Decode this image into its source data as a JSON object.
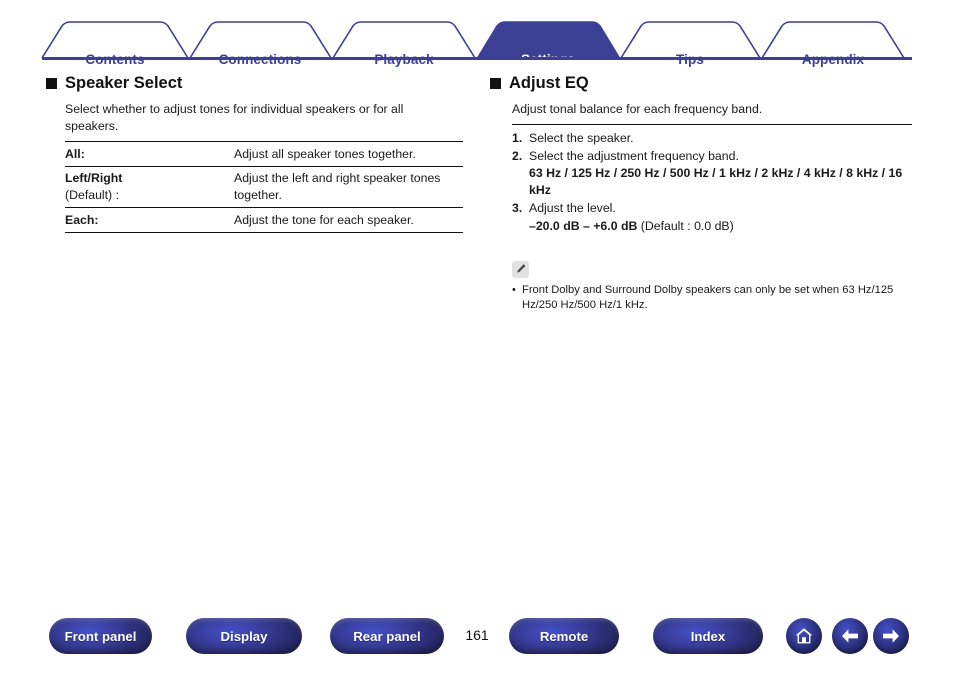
{
  "tabs": [
    {
      "label": "Contents",
      "active": false
    },
    {
      "label": "Connections",
      "active": false
    },
    {
      "label": "Playback",
      "active": false
    },
    {
      "label": "Settings",
      "active": true
    },
    {
      "label": "Tips",
      "active": false
    },
    {
      "label": "Appendix",
      "active": false
    }
  ],
  "left_section": {
    "title": "Speaker Select",
    "intro": "Select whether to adjust tones for individual speakers or for all speakers.",
    "rows": [
      {
        "term": "All:",
        "term_sub": "",
        "desc": "Adjust all speaker tones together."
      },
      {
        "term": "Left/Right",
        "term_sub": "(Default) :",
        "desc": "Adjust the left and right speaker tones together."
      },
      {
        "term": "Each:",
        "term_sub": "",
        "desc": "Adjust the tone for each speaker."
      }
    ]
  },
  "right_section": {
    "title": "Adjust EQ",
    "intro": "Adjust tonal balance for each frequency band.",
    "steps": [
      {
        "num": "1.",
        "text": "Select the speaker.",
        "sub": "",
        "sub_normal": ""
      },
      {
        "num": "2.",
        "text": "Select the adjustment frequency band.",
        "sub": "63 Hz / 125 Hz / 250 Hz / 500 Hz / 1 kHz / 2 kHz / 4 kHz / 8 kHz / 16 kHz",
        "sub_normal": ""
      },
      {
        "num": "3.",
        "text": "Adjust the level.",
        "sub": "–20.0 dB – +6.0 dB",
        "sub_normal": " (Default : 0.0 dB)"
      }
    ],
    "note": {
      "icon": "pencil-icon",
      "bullet": "•",
      "text": "Front Dolby and Surround Dolby speakers can only be set when 63 Hz/125 Hz/250 Hz/500 Hz/1 kHz."
    }
  },
  "footer": {
    "buttons": [
      {
        "label": "Front panel"
      },
      {
        "label": "Display"
      },
      {
        "label": "Rear panel"
      },
      {
        "label": "Remote"
      },
      {
        "label": "Index"
      }
    ],
    "page_number": "161",
    "icons": [
      {
        "name": "home-icon"
      },
      {
        "name": "arrow-left-icon"
      },
      {
        "name": "arrow-right-icon"
      }
    ]
  },
  "colors": {
    "brand_blue": "#3b4095",
    "text": "#1a1a1a",
    "note_icon_bg": "#e2e2e2"
  }
}
